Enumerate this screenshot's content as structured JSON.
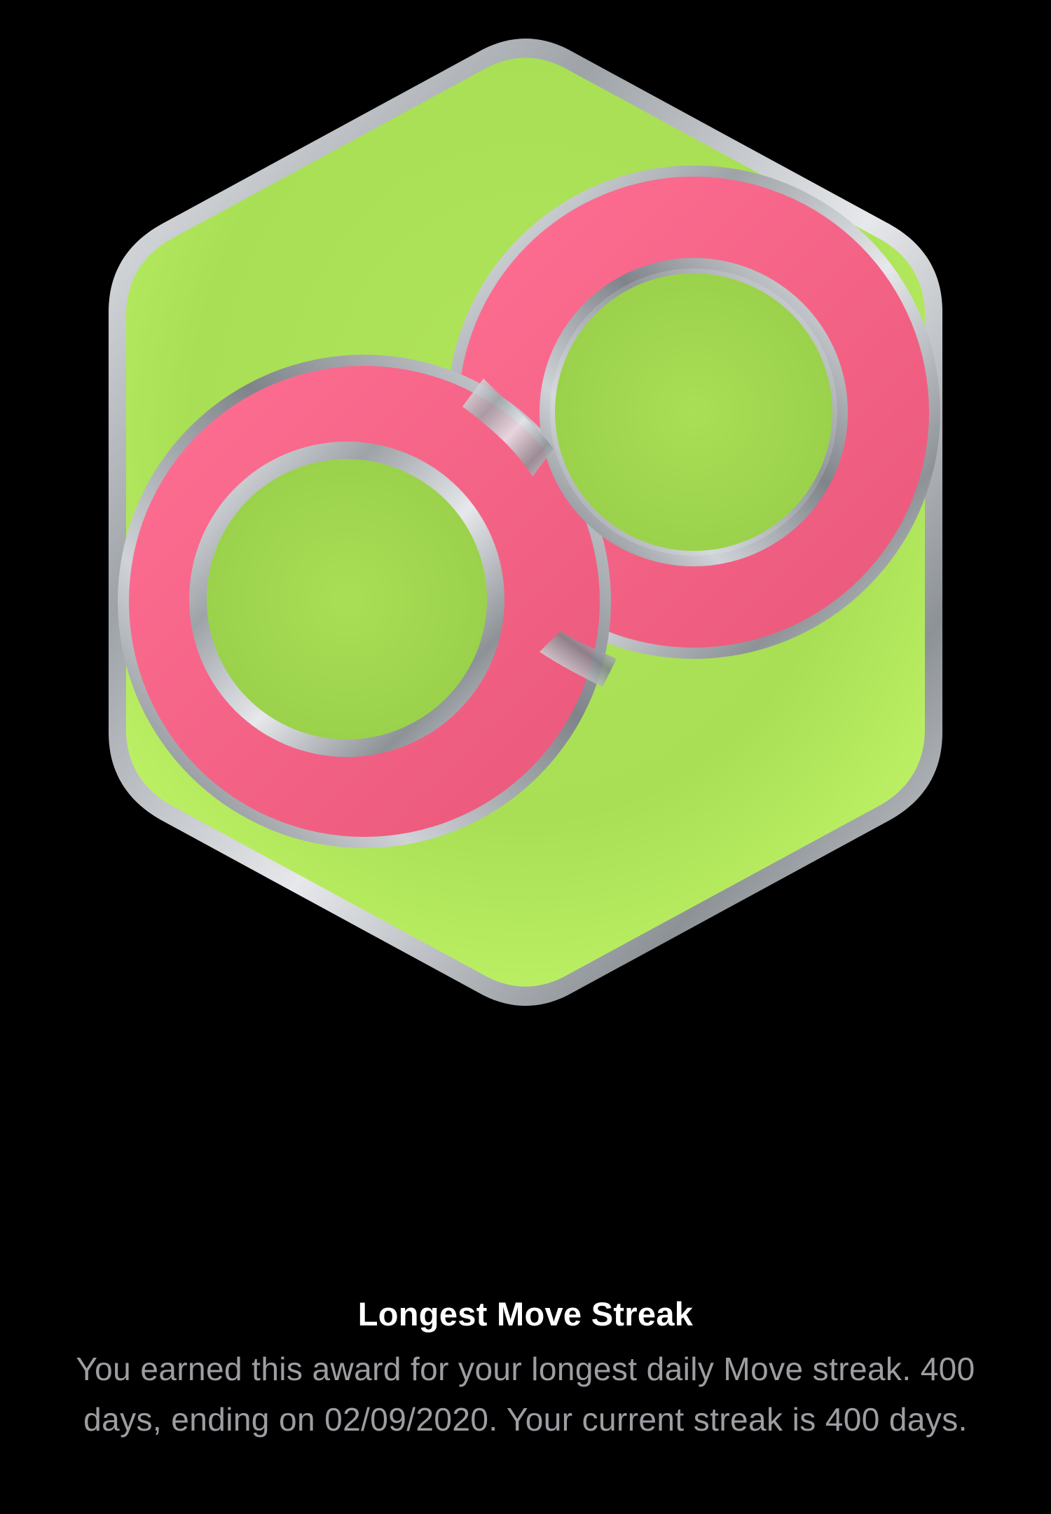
{
  "award": {
    "title": "Longest Move Streak",
    "description": "You earned this award for your longest daily Move streak. 400 days, ending on 02/09/2020. Your current streak is 400 days.",
    "badge_icon": "infinity-medal-icon"
  },
  "colors": {
    "background": "#000000",
    "badge_green": "#b4ec5a",
    "badge_pink": "#f2607f",
    "badge_silver": "#c7cbd0",
    "title_text": "#ffffff",
    "description_text": "#9d9da3"
  }
}
